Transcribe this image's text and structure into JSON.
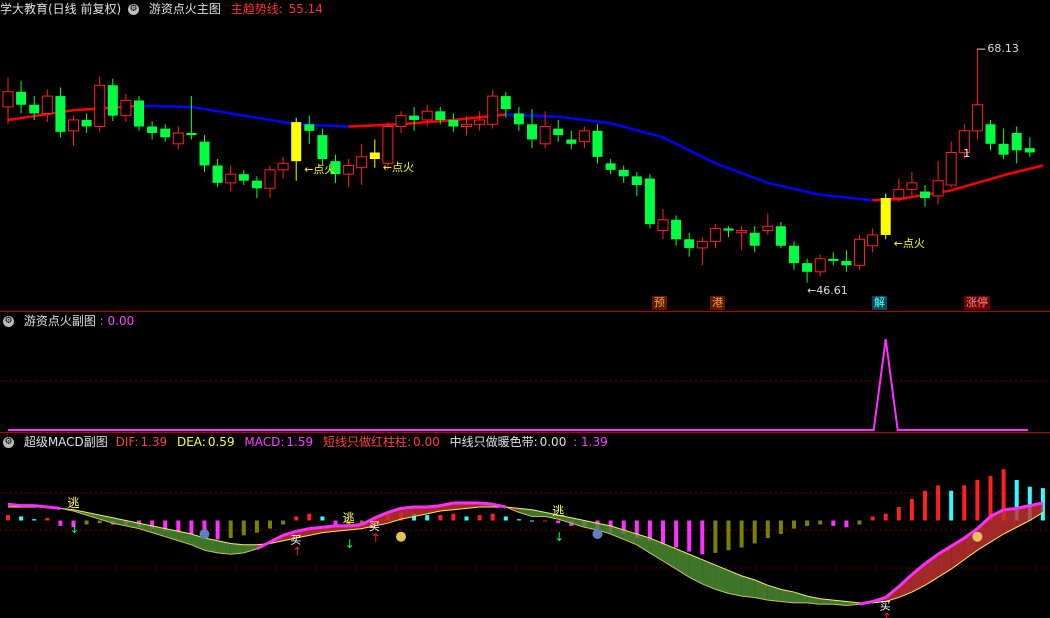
{
  "main_header": {
    "stock_label": "学大教育(日线 前复权)",
    "indicator_name": "游资点火主图",
    "trend_label": "主趋势线:",
    "trend_value": "55.14"
  },
  "main_annotations": {
    "high_price": "68.13",
    "low_price": "46.61",
    "fire_labels": [
      "←点火",
      "←点火",
      "←点火"
    ],
    "candle_number": "1"
  },
  "bottom_tags": [
    {
      "text": "预",
      "bg": "#5a1a00",
      "color": "#ff9a40"
    },
    {
      "text": "港",
      "bg": "#5a1a00",
      "color": "#ff9a40"
    },
    {
      "text": "解",
      "bg": "#004a5a",
      "color": "#60ffff"
    },
    {
      "text": "涨停",
      "bg": "#6a0000",
      "color": "#ff8080"
    }
  ],
  "sub_header": {
    "indicator_name": "游资点火副图",
    "value": ": 0.00"
  },
  "macd_header": {
    "indicator_name": "超级MACD副图",
    "dif_label": "DIF:",
    "dif_value": "1.39",
    "dea_label": "DEA:",
    "dea_value": "0.59",
    "macd_label": "MACD:",
    "macd_value": "1.59",
    "short_label": "短线只做红柱柱:",
    "short_value": "0.00",
    "mid_label": "中线只做暖色带:",
    "mid_value": "0.00",
    "extra_value": ": 1.39"
  },
  "macd_signals": {
    "escape": "逃",
    "buy": "买"
  },
  "colors": {
    "up": "#ff2020",
    "down": "#00ff40",
    "fire": "#ffff00",
    "ma_up": "#ff0000",
    "ma_down": "#0000ff",
    "dif": "#ff30ff",
    "dea": "#ffffff"
  },
  "chart_data": [
    {
      "type": "candlestick",
      "title": "游资点火主图",
      "candles": [
        {
          "o": 62.8,
          "c": 64.2,
          "h": 65.5,
          "l": 61.2
        },
        {
          "o": 64.2,
          "c": 63.0,
          "h": 65.2,
          "l": 62.2
        },
        {
          "o": 63.0,
          "c": 62.2,
          "h": 63.8,
          "l": 61.6
        },
        {
          "o": 62.2,
          "c": 63.8,
          "h": 64.4,
          "l": 61.4
        },
        {
          "o": 63.8,
          "c": 60.5,
          "h": 64.6,
          "l": 60.0
        },
        {
          "o": 60.6,
          "c": 61.6,
          "h": 62.0,
          "l": 59.2
        },
        {
          "o": 61.6,
          "c": 61.0,
          "h": 62.2,
          "l": 60.4
        },
        {
          "o": 61.0,
          "c": 64.8,
          "h": 65.6,
          "l": 60.5
        },
        {
          "o": 64.8,
          "c": 62.0,
          "h": 65.4,
          "l": 61.5
        },
        {
          "o": 62.0,
          "c": 63.4,
          "h": 64.0,
          "l": 61.4
        },
        {
          "o": 63.4,
          "c": 61.0,
          "h": 63.8,
          "l": 60.6
        },
        {
          "o": 61.0,
          "c": 60.4,
          "h": 61.5,
          "l": 59.8
        },
        {
          "o": 60.8,
          "c": 60.0,
          "h": 61.2,
          "l": 59.6
        },
        {
          "o": 59.4,
          "c": 60.4,
          "h": 61.0,
          "l": 58.9
        },
        {
          "o": 60.4,
          "c": 60.2,
          "h": 63.8,
          "l": 59.8
        },
        {
          "o": 59.6,
          "c": 57.4,
          "h": 60.2,
          "l": 56.8
        },
        {
          "o": 57.4,
          "c": 55.8,
          "h": 58.0,
          "l": 55.4
        },
        {
          "o": 55.8,
          "c": 56.6,
          "h": 57.4,
          "l": 55.0
        },
        {
          "o": 56.6,
          "c": 56.0,
          "h": 57.0,
          "l": 55.6
        },
        {
          "o": 56.0,
          "c": 55.3,
          "h": 56.4,
          "l": 54.4
        },
        {
          "o": 55.3,
          "c": 57.0,
          "h": 57.4,
          "l": 54.4
        },
        {
          "o": 57.0,
          "c": 57.6,
          "h": 58.2,
          "l": 56.2
        },
        {
          "o": 57.8,
          "c": 61.4,
          "h": 61.8,
          "l": 56.0
        },
        {
          "o": 61.2,
          "c": 60.6,
          "h": 62.0,
          "l": 59.4
        },
        {
          "o": 60.2,
          "c": 58.0,
          "h": 60.8,
          "l": 57.4
        },
        {
          "o": 57.8,
          "c": 56.6,
          "h": 58.4,
          "l": 55.8
        },
        {
          "o": 56.6,
          "c": 57.4,
          "h": 58.0,
          "l": 55.4
        },
        {
          "o": 57.2,
          "c": 58.2,
          "h": 59.4,
          "l": 55.6
        },
        {
          "o": 58.0,
          "c": 58.6,
          "h": 59.8,
          "l": 57.2
        },
        {
          "o": 57.6,
          "c": 61.0,
          "h": 61.4,
          "l": 57.0
        },
        {
          "o": 61.0,
          "c": 62.0,
          "h": 62.4,
          "l": 60.4
        },
        {
          "o": 62.0,
          "c": 61.6,
          "h": 62.8,
          "l": 60.6
        },
        {
          "o": 61.6,
          "c": 62.4,
          "h": 63.0,
          "l": 61.0
        },
        {
          "o": 62.4,
          "c": 61.6,
          "h": 62.8,
          "l": 61.2
        },
        {
          "o": 61.6,
          "c": 61.0,
          "h": 62.2,
          "l": 60.5
        },
        {
          "o": 61.0,
          "c": 61.2,
          "h": 62.0,
          "l": 60.2
        },
        {
          "o": 61.2,
          "c": 61.6,
          "h": 62.4,
          "l": 60.6
        },
        {
          "o": 61.2,
          "c": 63.8,
          "h": 64.4,
          "l": 60.8
        },
        {
          "o": 63.8,
          "c": 62.6,
          "h": 64.2,
          "l": 61.8
        },
        {
          "o": 62.2,
          "c": 61.2,
          "h": 62.8,
          "l": 60.6
        },
        {
          "o": 61.2,
          "c": 59.8,
          "h": 62.6,
          "l": 59.0
        },
        {
          "o": 59.4,
          "c": 61.0,
          "h": 62.4,
          "l": 59.0
        },
        {
          "o": 60.8,
          "c": 60.2,
          "h": 61.6,
          "l": 59.6
        },
        {
          "o": 59.8,
          "c": 59.4,
          "h": 60.6,
          "l": 58.9
        },
        {
          "o": 59.6,
          "c": 60.6,
          "h": 61.0,
          "l": 59.0
        },
        {
          "o": 60.6,
          "c": 58.2,
          "h": 61.2,
          "l": 57.6
        },
        {
          "o": 57.6,
          "c": 57.0,
          "h": 58.0,
          "l": 56.6
        },
        {
          "o": 57.0,
          "c": 56.4,
          "h": 57.4,
          "l": 55.8
        },
        {
          "o": 56.4,
          "c": 55.6,
          "h": 56.8,
          "l": 54.6
        },
        {
          "o": 56.2,
          "c": 52.0,
          "h": 56.6,
          "l": 51.6
        },
        {
          "o": 51.4,
          "c": 52.4,
          "h": 53.4,
          "l": 50.6
        },
        {
          "o": 52.4,
          "c": 50.6,
          "h": 52.8,
          "l": 50.0
        },
        {
          "o": 50.6,
          "c": 49.8,
          "h": 51.2,
          "l": 49.0
        },
        {
          "o": 49.8,
          "c": 50.4,
          "h": 50.8,
          "l": 48.2
        },
        {
          "o": 50.4,
          "c": 51.6,
          "h": 52.0,
          "l": 49.8
        },
        {
          "o": 51.6,
          "c": 51.4,
          "h": 51.8,
          "l": 50.8
        },
        {
          "o": 51.2,
          "c": 51.4,
          "h": 51.8,
          "l": 49.6
        },
        {
          "o": 51.2,
          "c": 50.0,
          "h": 51.8,
          "l": 49.4
        },
        {
          "o": 51.4,
          "c": 51.8,
          "h": 53.0,
          "l": 51.0
        },
        {
          "o": 51.8,
          "c": 50.0,
          "h": 52.2,
          "l": 49.8
        },
        {
          "o": 50.0,
          "c": 48.4,
          "h": 50.4,
          "l": 47.8
        },
        {
          "o": 48.4,
          "c": 47.6,
          "h": 48.8,
          "l": 46.6
        },
        {
          "o": 47.6,
          "c": 48.8,
          "h": 49.2,
          "l": 47.2
        },
        {
          "o": 48.8,
          "c": 48.6,
          "h": 49.4,
          "l": 48.2
        },
        {
          "o": 48.6,
          "c": 48.2,
          "h": 49.6,
          "l": 47.6
        },
        {
          "o": 48.2,
          "c": 50.6,
          "h": 51.0,
          "l": 47.8
        },
        {
          "o": 50.0,
          "c": 51.0,
          "h": 51.6,
          "l": 49.4
        },
        {
          "o": 51.0,
          "c": 54.4,
          "h": 54.8,
          "l": 50.6
        },
        {
          "o": 54.4,
          "c": 55.2,
          "h": 56.2,
          "l": 54.0
        },
        {
          "o": 55.2,
          "c": 55.8,
          "h": 56.8,
          "l": 54.6
        },
        {
          "o": 55.0,
          "c": 54.4,
          "h": 55.6,
          "l": 53.6
        },
        {
          "o": 54.6,
          "c": 56.0,
          "h": 57.8,
          "l": 53.8
        },
        {
          "o": 55.6,
          "c": 58.6,
          "h": 59.6,
          "l": 55.4
        },
        {
          "o": 58.6,
          "c": 60.6,
          "h": 61.2,
          "l": 58.0
        },
        {
          "o": 60.6,
          "c": 63.0,
          "h": 68.13,
          "l": 59.8
        },
        {
          "o": 61.2,
          "c": 59.4,
          "h": 61.6,
          "l": 58.8
        },
        {
          "o": 59.4,
          "c": 58.4,
          "h": 60.8,
          "l": 58.0
        },
        {
          "o": 60.4,
          "c": 58.8,
          "h": 61.0,
          "l": 57.6
        },
        {
          "o": 59.0,
          "c": 58.6,
          "h": 60.0,
          "l": 58.2
        }
      ],
      "fire_candle_indices": [
        22,
        28,
        67
      ],
      "trend_line": [
        {
          "i": 0,
          "v": 61.6
        },
        {
          "i": 5,
          "v": 62.5
        },
        {
          "i": 10,
          "v": 62.9
        },
        {
          "i": 14,
          "v": 62.8
        },
        {
          "i": 18,
          "v": 62.0
        },
        {
          "i": 22,
          "v": 61.2
        },
        {
          "i": 26,
          "v": 61.0
        },
        {
          "i": 30,
          "v": 61.2
        },
        {
          "i": 34,
          "v": 61.6
        },
        {
          "i": 38,
          "v": 62.1
        },
        {
          "i": 42,
          "v": 61.9
        },
        {
          "i": 46,
          "v": 61.3
        },
        {
          "i": 50,
          "v": 60.0
        },
        {
          "i": 54,
          "v": 57.6
        },
        {
          "i": 58,
          "v": 55.8
        },
        {
          "i": 62,
          "v": 54.7
        },
        {
          "i": 66,
          "v": 54.2
        },
        {
          "i": 68,
          "v": 54.3
        },
        {
          "i": 72,
          "v": 55.1
        },
        {
          "i": 76,
          "v": 56.5
        },
        {
          "i": 79,
          "v": 57.4
        }
      ],
      "ylim": [
        45,
        71
      ]
    },
    {
      "type": "line",
      "title": "游资点火副图",
      "values_note": "",
      "spike_index": 67,
      "spike_value": 1,
      "ylim": [
        0,
        1.1
      ]
    },
    {
      "type": "bar",
      "title": "超级MACD副图",
      "macd": [
        0.4,
        0.3,
        0.1,
        0.2,
        -0.4,
        -0.5,
        -0.3,
        -0.2,
        -0.3,
        -0.4,
        -0.5,
        -0.6,
        -0.8,
        -0.9,
        -1.0,
        -1.2,
        -1.4,
        -1.3,
        -1.1,
        -0.9,
        -0.6,
        -0.3,
        0.3,
        0.5,
        0.3,
        -0.4,
        -0.3,
        -0.2,
        0.2,
        0.5,
        0.6,
        0.5,
        0.4,
        0.4,
        0.5,
        0.3,
        0.4,
        0.5,
        0.3,
        0.1,
        0.0,
        0.0,
        -0.2,
        -0.4,
        -0.5,
        -0.7,
        -0.9,
        -1.0,
        -1.3,
        -1.5,
        -1.8,
        -2.0,
        -2.3,
        -2.5,
        -2.4,
        -2.2,
        -2.0,
        -1.7,
        -1.3,
        -1.0,
        -0.6,
        -0.4,
        -0.3,
        -0.4,
        -0.5,
        -0.3,
        0.3,
        0.5,
        1.0,
        1.6,
        2.2,
        2.6,
        2.2,
        2.6,
        3.0,
        3.3,
        3.8,
        3.0,
        2.5,
        2.4
      ],
      "dif": [
        1.2,
        1.1,
        1.1,
        1.0,
        0.9,
        0.7,
        0.4,
        0.1,
        -0.2,
        -0.4,
        -0.6,
        -0.9,
        -1.2,
        -1.5,
        -1.8,
        -2.2,
        -2.4,
        -2.5,
        -2.4,
        -2.1,
        -1.6,
        -1.1,
        -0.8,
        -0.6,
        -0.5,
        -0.4,
        -0.4,
        -0.3,
        0.2,
        0.6,
        0.9,
        1.0,
        1.0,
        1.1,
        1.3,
        1.3,
        1.3,
        1.2,
        1.0,
        0.6,
        0.3,
        0.3,
        0.1,
        -0.2,
        -0.5,
        -0.7,
        -1.0,
        -1.4,
        -1.8,
        -2.4,
        -3.0,
        -3.6,
        -4.2,
        -4.7,
        -5.1,
        -5.4,
        -5.6,
        -5.7,
        -5.9,
        -6.0,
        -6.1,
        -6.1,
        -6.2,
        -6.2,
        -6.3,
        -6.2,
        -6.0,
        -5.7,
        -4.9,
        -4.0,
        -3.2,
        -2.5,
        -1.9,
        -1.3,
        -0.6,
        0.3,
        0.8,
        0.9,
        1.1,
        1.3
      ],
      "dea": [
        1.0,
        1.0,
        1.0,
        1.0,
        0.9,
        0.8,
        0.6,
        0.4,
        0.2,
        0.0,
        -0.2,
        -0.4,
        -0.6,
        -0.8,
        -1.0,
        -1.3,
        -1.5,
        -1.7,
        -1.8,
        -1.8,
        -1.7,
        -1.5,
        -1.3,
        -1.1,
        -0.9,
        -0.8,
        -0.7,
        -0.6,
        -0.4,
        -0.2,
        0.1,
        0.3,
        0.5,
        0.7,
        0.8,
        0.9,
        1.0,
        1.0,
        1.0,
        0.9,
        0.8,
        0.6,
        0.4,
        0.2,
        0.0,
        -0.2,
        -0.4,
        -0.7,
        -1.0,
        -1.3,
        -1.7,
        -2.1,
        -2.5,
        -2.9,
        -3.3,
        -3.7,
        -4.1,
        -4.4,
        -4.8,
        -5.1,
        -5.3,
        -5.6,
        -5.8,
        -5.9,
        -6.0,
        -6.1,
        -6.1,
        -6.0,
        -5.7,
        -5.3,
        -4.8,
        -4.2,
        -3.6,
        -2.9,
        -2.2,
        -1.6,
        -1.0,
        -0.5,
        0.0,
        0.6
      ],
      "ylim": [
        -7,
        5
      ]
    }
  ]
}
